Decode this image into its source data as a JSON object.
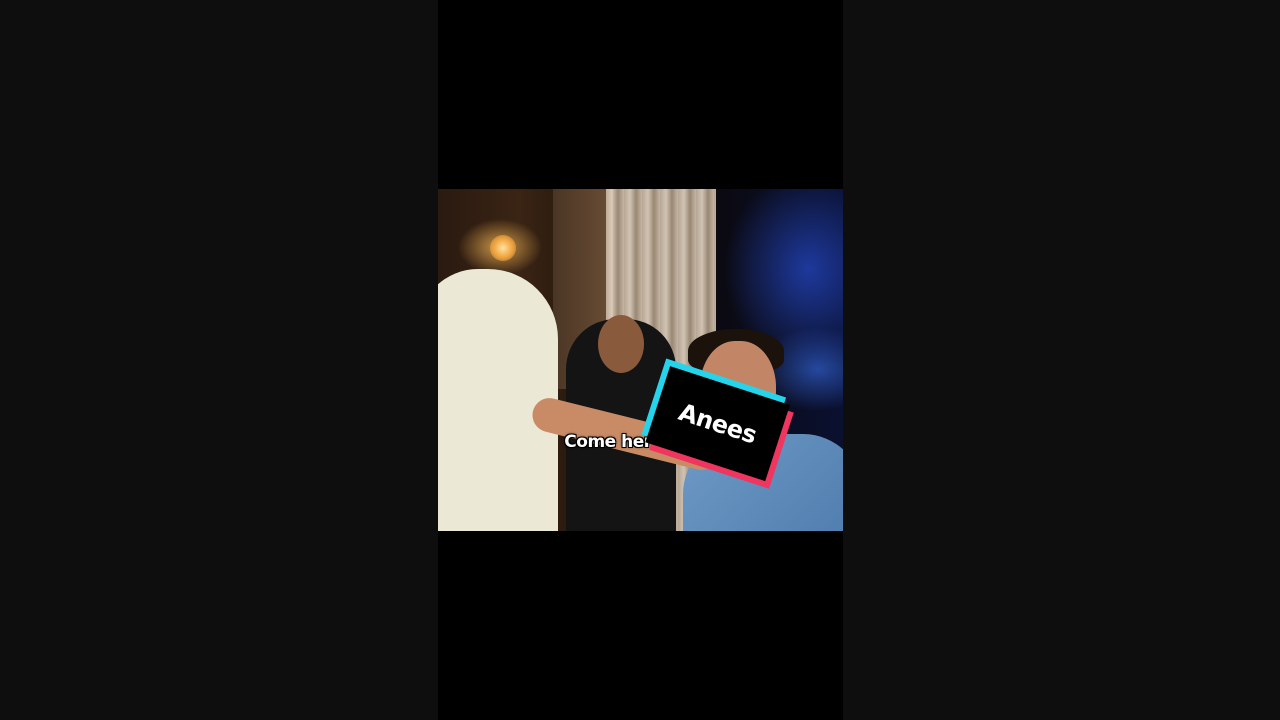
{
  "video": {
    "caption": "Come here bro...",
    "name_sticker": "Anees"
  },
  "colors": {
    "page_background": "#0e0e0e",
    "video_background": "#000000",
    "sticker_cyan": "#25d4eb",
    "sticker_red": "#f0355e",
    "sticker_black": "#000000",
    "caption_color": "#ffffff"
  }
}
